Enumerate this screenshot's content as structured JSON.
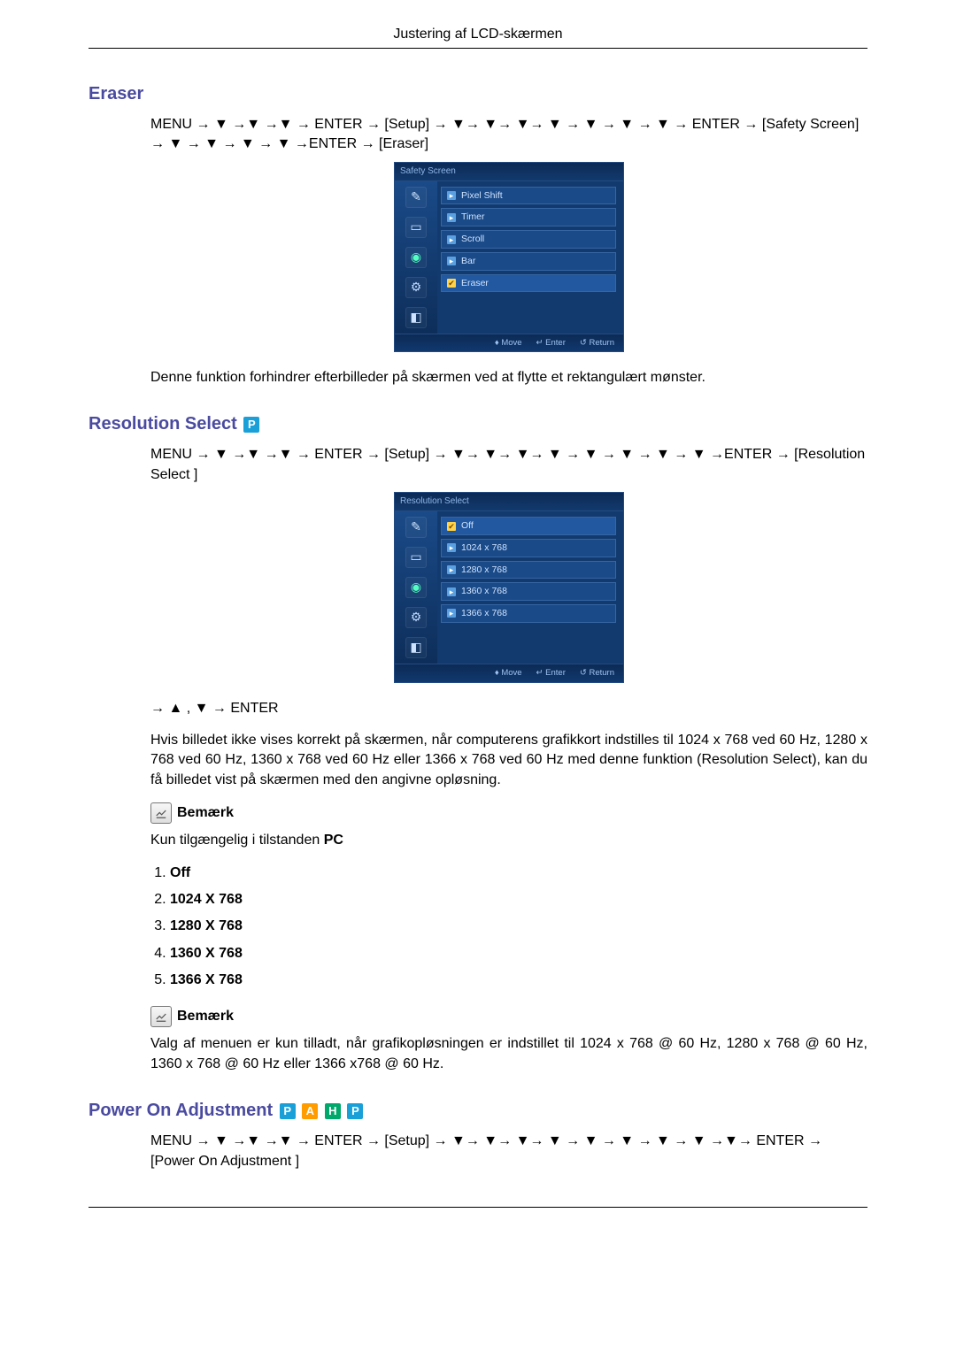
{
  "header": {
    "title": "Justering af LCD-skærmen"
  },
  "sections": {
    "eraser": {
      "title": "Eraser",
      "path": "MENU → ▼ →▼ →▼ → ENTER → [Setup] → ▼→ ▼→ ▼→ ▼ → ▼ → ▼ → ▼ → ENTER → [Safety Screen] → ▼ → ▼ → ▼ → ▼ →ENTER → [Eraser]",
      "osd": {
        "title": "Safety Screen",
        "items": [
          "Pixel Shift",
          "Timer",
          "Scroll",
          "Bar",
          "Eraser"
        ],
        "selectedIndex": 4,
        "footer": {
          "move": "Move",
          "enter": "Enter",
          "return": "Return"
        }
      },
      "body": "Denne funktion forhindrer efterbilleder på skærmen ved at flytte et rektangulært mønster."
    },
    "resolution": {
      "title": "Resolution Select",
      "badges": [
        "P"
      ],
      "path": "MENU → ▼ →▼ →▼ → ENTER → [Setup] → ▼→ ▼→ ▼→ ▼ → ▼ → ▼ → ▼ → ▼ →ENTER → [Resolution Select ]",
      "osd": {
        "title": "Resolution Select",
        "items": [
          "Off",
          "1024 x 768",
          "1280 x 768",
          "1360 x 768",
          "1366 x 768"
        ],
        "selectedIndex": 0,
        "footer": {
          "move": "Move",
          "enter": "Enter",
          "return": "Return"
        }
      },
      "nav_hint": "→ ▲ , ▼ → ENTER",
      "body": "Hvis billedet ikke vises korrekt på skærmen, når computerens grafikkort indstilles til 1024 x 768 ved 60 Hz, 1280 x 768 ved 60 Hz, 1360 x 768 ved 60 Hz eller 1366 x 768 ved 60 Hz med denne funktion (Resolution Select), kan du få billedet vist på skærmen med den angivne opløsning.",
      "note1_label": "Bemærk",
      "note1_text_prefix": "Kun tilgængelig i tilstanden ",
      "note1_text_bold": "PC",
      "list": [
        "Off",
        "1024 X 768",
        "1280 X 768",
        "1360 X 768",
        "1366 X 768"
      ],
      "note2_label": "Bemærk",
      "note2_text": "Valg af menuen er kun tilladt, når grafikopløsningen er indstillet til 1024 x 768 @ 60 Hz, 1280 x 768 @ 60 Hz, 1360 x 768 @ 60 Hz eller 1366 x768 @ 60 Hz."
    },
    "poweron": {
      "title": "Power On Adjustment",
      "badges": [
        "P",
        "A",
        "H",
        "P"
      ],
      "path": "MENU → ▼ →▼ →▼ → ENTER → [Setup] → ▼→ ▼→ ▼→ ▼ → ▼ → ▼ → ▼ → ▼ →▼→ ENTER → [Power On Adjustment ]"
    }
  },
  "icons": {
    "move_glyph": "♦",
    "enter_glyph": "↵",
    "return_glyph": "↺"
  }
}
